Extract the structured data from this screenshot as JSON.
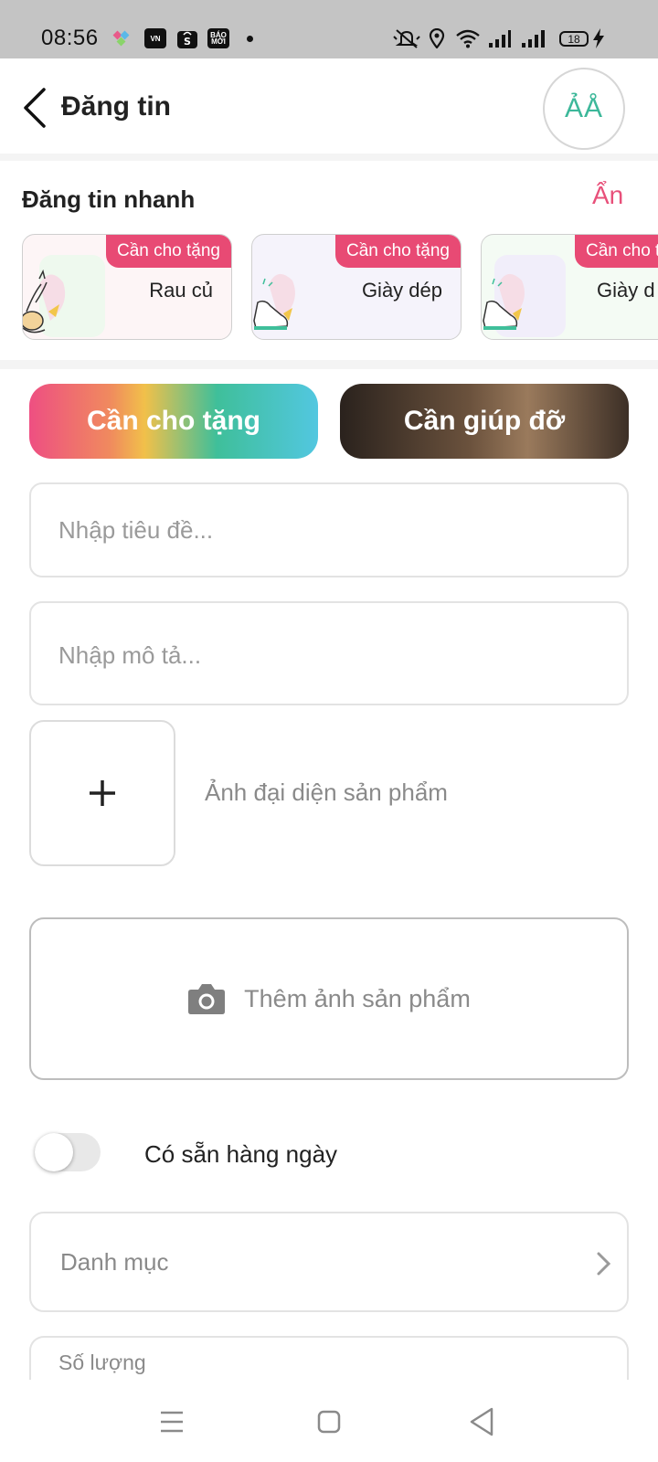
{
  "status_bar": {
    "time": "08:56",
    "battery": "18",
    "icons": [
      "app-badge-icon",
      "vnexpress-icon",
      "shopee-icon",
      "baomoi-icon",
      "notification-dot-icon",
      "mute-icon",
      "location-icon",
      "wifi-icon",
      "signal-icon",
      "signal-icon",
      "battery-icon",
      "charging-icon"
    ],
    "app_vn": "VN",
    "app_baomoi": "BÁO MỚI"
  },
  "header": {
    "title": "Đăng tin",
    "font_button": "ẢÅ"
  },
  "quick_post": {
    "title": "Đăng tin nhanh",
    "hide_label": "Ẩn",
    "cards": [
      {
        "badge": "Cần cho tặng",
        "label": "Rau củ"
      },
      {
        "badge": "Cần cho tặng",
        "label": "Giày dép"
      },
      {
        "badge": "Cần cho tặng",
        "label": "Giày d"
      }
    ]
  },
  "tabs": {
    "give": "Cần cho tặng",
    "help": "Cần giúp đỡ"
  },
  "form": {
    "title_placeholder": "Nhập tiêu đề...",
    "description_placeholder": "Nhập mô tả...",
    "avatar_label": "Ảnh đại diện sản phẩm",
    "add_photos_label": "Thêm ảnh sản phẩm",
    "daily_available_label": "Có sẵn hàng ngày",
    "daily_available_on": false,
    "category_label": "Danh mục",
    "quantity_label": "Số lượng"
  },
  "colors": {
    "accent_pink": "#e84a74",
    "accent_green": "#3db89a"
  }
}
